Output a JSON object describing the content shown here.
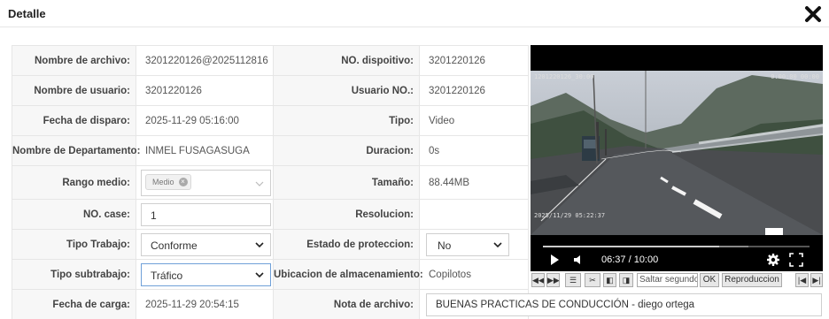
{
  "dialog": {
    "title": "Detalle"
  },
  "fields": {
    "nombre_archivo": {
      "label": "Nombre de archivo:",
      "value": "3201220126@2025112816"
    },
    "no_dispositivo": {
      "label": "NO. dispoitivo:",
      "value": "3201220126"
    },
    "nombre_usuario": {
      "label": "Nombre de usuario:",
      "value": "3201220126"
    },
    "usuario_no": {
      "label": "Usuario NO.:",
      "value": "3201220126"
    },
    "fecha_disparo": {
      "label": "Fecha de disparo:",
      "value": "2025-11-29 05:16:00"
    },
    "tipo": {
      "label": "Tipo:",
      "value": "Video"
    },
    "departamento": {
      "label": "Nombre de Departamento:",
      "value": "INMEL FUSAGASUGA"
    },
    "duracion": {
      "label": "Duracion:",
      "value": "0s"
    },
    "rango_medio": {
      "label": "Rango medio:",
      "value": "Medio"
    },
    "tamano": {
      "label": "Tamaño:",
      "value": "88.44MB"
    },
    "no_case": {
      "label": "NO. case:",
      "value": "1"
    },
    "resolucion": {
      "label": "Resolucion:",
      "value": ""
    },
    "tipo_trabajo": {
      "label": "Tipo Trabajo:",
      "value": "Conforme"
    },
    "estado_proteccion": {
      "label": "Estado de proteccion:",
      "value": "No"
    },
    "tipo_subtrabajo": {
      "label": "Tipo subtrabajo:",
      "value": "Tráfico"
    },
    "ubicacion": {
      "label": "Ubicacion de almacenamiento:",
      "value": "Copilotos"
    },
    "fecha_carga": {
      "label": "Fecha de carga:",
      "value": "2025-11-29 20:54:15"
    },
    "nota_archivo": {
      "label": "Nota de archivo:",
      "value": "BUENAS PRACTICAS DE CONDUCCIÓN - diego ortega"
    }
  },
  "player": {
    "overlay_top_left": "1201220126_30:00",
    "overlay_top_right": "0:00:00 00:00",
    "overlay_bottom": "2025/11/29 05:22:37",
    "time": "06:37 / 10:00",
    "progress_fraction": 0.661,
    "buffered_fraction": 0.77
  },
  "toolbar": {
    "seek_input_placeholder": "Saltar segundos",
    "ok_label": "OK",
    "playback_label": "Reproduccion"
  }
}
